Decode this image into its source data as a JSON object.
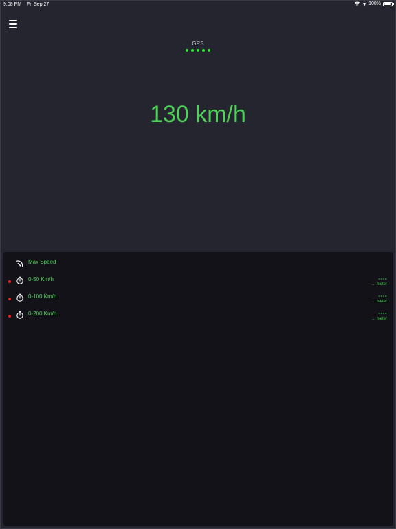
{
  "status_bar": {
    "time": "9:08 PM",
    "date": "Fri Sep 27",
    "battery_text": "100%"
  },
  "gps": {
    "label": "GPS",
    "signal_dots": 5,
    "color": "#2ee81f"
  },
  "speed": {
    "value": "130 km/h",
    "color": "#4fd159"
  },
  "panel": {
    "max_speed_label": "Max Speed",
    "timers": [
      {
        "label": "0-50 Km/h",
        "value": "----",
        "unit": "... meter"
      },
      {
        "label": "0-100 Km/h",
        "value": "----",
        "unit": "... meter"
      },
      {
        "label": "0-200 Km/h",
        "value": "----",
        "unit": "... meter"
      }
    ]
  },
  "colors": {
    "accent": "#4fd159",
    "record_dot": "#e8211d",
    "background": "#25252f",
    "panel": "#121218"
  },
  "icons": {
    "menu": "hamburger-icon",
    "wifi": "wifi-icon",
    "location": "location-arrow-icon",
    "battery": "battery-icon",
    "max_speed": "speedometer-icon",
    "timer": "stopwatch-icon"
  }
}
